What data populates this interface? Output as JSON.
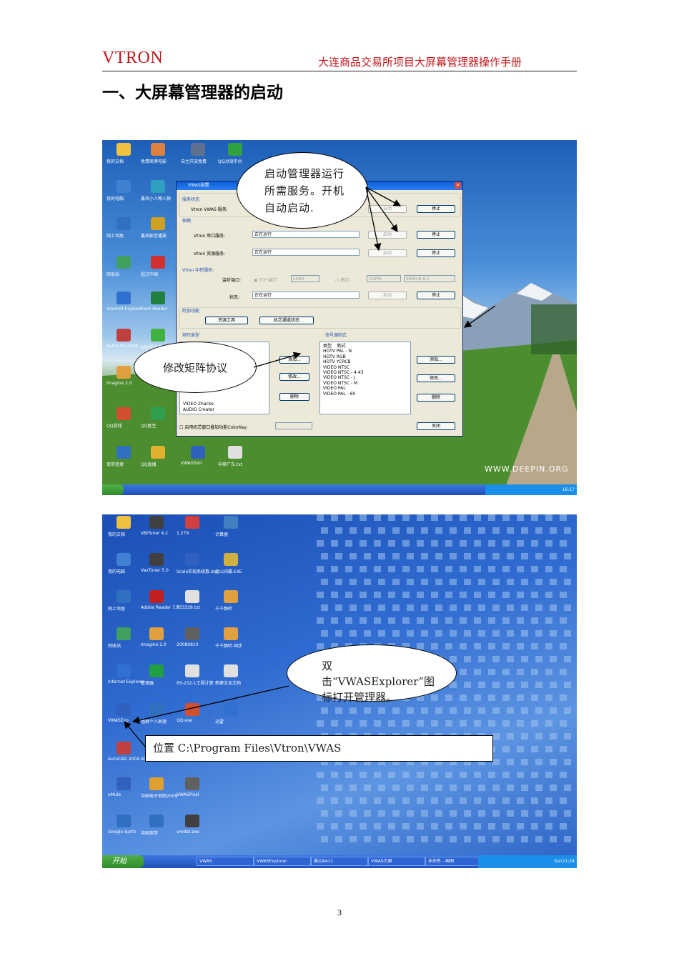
{
  "header": {
    "brand": "VTRON",
    "title": "大连商品交易所项目大屏幕管理器操作手册"
  },
  "section_title": "一、大屏幕管理器的启动",
  "screenshot1": {
    "desktop_icons": [
      {
        "label": "我的文档",
        "color": "#f0c040"
      },
      {
        "label": "免费商港电影",
        "color": "#e08040"
      },
      {
        "label": "自主开放免费",
        "color": "#607090"
      },
      {
        "label": "QQ对战平台",
        "color": "#30a040"
      },
      {
        "label": "我的电脑",
        "color": "#4080d0"
      },
      {
        "label": "暴风小人物人狼",
        "color": "#30a0c0"
      },
      {
        "label": "网上邻居",
        "color": "#3070c0"
      },
      {
        "label": "暴风影音播放",
        "color": "#d0a020"
      },
      {
        "label": "回收站",
        "color": "#40a060"
      },
      {
        "label": "超过中国",
        "color": "#d03030"
      },
      {
        "label": "Internet Explorer",
        "color": "#2f70d0"
      },
      {
        "label": "Foxit Reader",
        "color": "#208040"
      },
      {
        "label": "AutoCAD 2004",
        "color": "#c04040"
      },
      {
        "label": "360安全卫士",
        "color": "#40b040"
      },
      {
        "label": "Imagine 2.0",
        "color": "#e0a040"
      },
      {
        "label": "QQ游戏",
        "color": "#d05030"
      },
      {
        "label": "QQ医生",
        "color": "#30a050"
      },
      {
        "label": "宽带连接",
        "color": "#3070c0"
      },
      {
        "label": "QQ直播",
        "color": "#e0b030"
      },
      {
        "label": "VWASTool",
        "color": "#3060c0"
      },
      {
        "label": "中鼎广东.txt",
        "color": "#e0e0e0"
      }
    ],
    "watermark": "WWW.DEEPIN.ORG",
    "taskbar_clock": "16:17",
    "dialog": {
      "title": "VWAS配置",
      "service_status": "服务状态",
      "vwas_service_label": "Vtron VWAS 服务:",
      "start": "启动",
      "stop": "停止",
      "depends": "依赖",
      "serial_service_label": "Vtron 串口服务:",
      "serial_status": "正在运行",
      "resource_service_label": "Vtron 资源服务:",
      "resource_status": "正在运行",
      "control_service": "Vtron 中控服务:",
      "listen_port_label": "监听端口:",
      "tcp_label": "TCP 端口",
      "tcp_port": "5000",
      "serial_label": "串口",
      "com_port": "COM3",
      "baud": "9600,N,8,1",
      "state_label": "状态:",
      "control_status": "正在运行",
      "aux_functions": "附加功能",
      "resource_tool": "资源工具",
      "channel_status": "机芯通道状态",
      "matrix_type": "矩阵类型",
      "signal_source_mode": "信号源制式",
      "matrix_list": [
        "VIDEO  Zhacke",
        "AUDIO  Creator"
      ],
      "signal_header": [
        "类型",
        "制式"
      ],
      "signal_list": [
        [
          "HDTV",
          "PAL - N"
        ],
        [
          "HDTV",
          "RGB"
        ],
        [
          "HDTV",
          "YCRCB"
        ],
        [
          "VIDEO",
          "NTSC"
        ],
        [
          "VIDEO",
          "NTSC - 4.43"
        ],
        [
          "VIDEO",
          "NTSC - J"
        ],
        [
          "VIDEO",
          "NTSC - M"
        ],
        [
          "VIDEO",
          "PAL"
        ],
        [
          "VIDEO",
          "PAL - 60"
        ]
      ],
      "add": "添加...",
      "modify": "修改...",
      "delete": "删除",
      "colorkey_label": "启用机芯窗口叠加功能ColorKey:",
      "close": "关闭"
    },
    "callout_start_manager": "启动管理器运行所需服务。开机自动启动.",
    "callout_matrix": "修改矩阵协议"
  },
  "screenshot2": {
    "desktop_icons": [
      {
        "label": "我的文档",
        "color": "#f0c040"
      },
      {
        "label": "VBITuner 4.2",
        "color": "#404040"
      },
      {
        "label": "1.279",
        "color": "#d04040"
      },
      {
        "label": "计算器",
        "color": "#4080c0"
      },
      {
        "label": "我的电脑",
        "color": "#4080d0"
      },
      {
        "label": "VaxTuner 5.0",
        "color": "#404040"
      },
      {
        "label": "Scale实现系统数.doc",
        "color": "#3060c0"
      },
      {
        "label": "金山词霸.EXE",
        "color": "#d0b040"
      },
      {
        "label": "网上邻居",
        "color": "#3070c0"
      },
      {
        "label": "Adobe Reader 7.0",
        "color": "#c02020"
      },
      {
        "label": "TS3329.txt",
        "color": "#e0e0e0"
      },
      {
        "label": "千千静听",
        "color": "#e0a040"
      },
      {
        "label": "回收站",
        "color": "#40a060"
      },
      {
        "label": "Imagine 2.0",
        "color": "#e0a040"
      },
      {
        "label": "20080810",
        "color": "#606060"
      },
      {
        "label": "千千静听-同步",
        "color": "#e0a040"
      },
      {
        "label": "Internet Explorer",
        "color": "#2f70d0"
      },
      {
        "label": "管理器",
        "color": "#20a040"
      },
      {
        "label": "RS-232-1工程计算",
        "color": "#e0e0e0"
      },
      {
        "label": "新建文本文档",
        "color": "#e0e0e0"
      },
      {
        "label": "VWASExp",
        "color": "#3060c0"
      },
      {
        "label": "墙屏个人助理",
        "color": "#3070c0"
      },
      {
        "label": "QQ.exe",
        "color": "#d05030"
      },
      {
        "label": "迅雷",
        "color": "#3070d0"
      },
      {
        "label": "AutoCAD 2004",
        "color": "#c04040"
      },
      {
        "label": "ACDSee",
        "color": "#40a0d0"
      },
      {
        "label": "eMule",
        "color": "#3060c0"
      },
      {
        "label": "中国电子地图2009",
        "color": "#e0a030"
      },
      {
        "label": "VWASPixel",
        "color": "#606060"
      },
      {
        "label": "Google Earth",
        "color": "#3070c0"
      },
      {
        "label": "中国宽带",
        "color": "#3070c0"
      },
      {
        "label": "vmdat.exe",
        "color": "#404040"
      }
    ],
    "start_label": "开始",
    "taskbar_items": [
      "VWAS",
      "VWASExplorer",
      "黄山8411",
      "VWAS大屏",
      "未命名 - 画图"
    ],
    "taskbar_clock": "Sun21:24",
    "callout_double_click": "双击“VWASExplorer”图标打开管理器。",
    "location_box": "位置 C:\\Program Files\\Vtron\\VWAS"
  },
  "page_number": "3"
}
